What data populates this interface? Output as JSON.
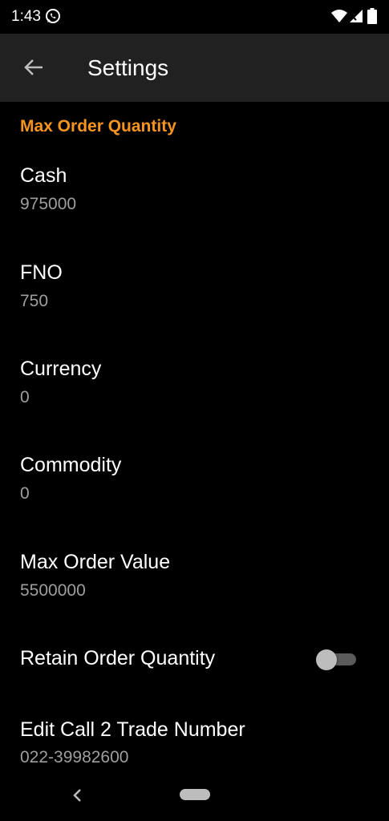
{
  "status_bar": {
    "time": "1:43",
    "icons": [
      "whatsapp-icon",
      "wifi-icon",
      "signal-icon",
      "battery-icon"
    ]
  },
  "app_bar": {
    "title": "Settings",
    "back_icon": "arrow-left-icon"
  },
  "section": {
    "header": "Max Order Quantity",
    "header_color": "#f7941d"
  },
  "items": [
    {
      "title": "Cash",
      "summary": "975000"
    },
    {
      "title": "FNO",
      "summary": "750"
    },
    {
      "title": "Currency",
      "summary": "0"
    },
    {
      "title": "Commodity",
      "summary": "0"
    },
    {
      "title": "Max Order Value",
      "summary": "5500000"
    }
  ],
  "retain_toggle": {
    "title": "Retain Order Quantity",
    "enabled": false
  },
  "edit_call": {
    "title": "Edit Call 2 Trade Number",
    "summary": "022-39982600"
  },
  "nav_bar": {
    "icons": [
      "nav-back-icon",
      "home-pill-icon"
    ]
  },
  "colors": {
    "background": "#000000",
    "app_bar": "#212121",
    "accent": "#f7941d",
    "summary_text": "#9e9e9e"
  }
}
